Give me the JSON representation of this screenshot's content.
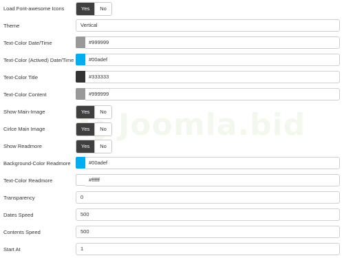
{
  "rows": {
    "load_icons": {
      "label": "Load Font-awesome Icons",
      "yes": "Yes",
      "no": "No",
      "selected": "Yes"
    },
    "theme": {
      "label": "Theme",
      "value": "Vertical"
    },
    "text_color_datetime": {
      "label": "Text-Color Date/Time",
      "value": "#999999",
      "color": "#999999"
    },
    "text_color_actived": {
      "label": "Text-Color (Actived) Date/Time",
      "value": "#00adef",
      "color": "#00adef"
    },
    "text_color_title": {
      "label": "Text-Color Title",
      "value": "#333333",
      "color": "#333333"
    },
    "text_color_content": {
      "label": "Text-Color Content",
      "value": "#999999",
      "color": "#999999"
    },
    "show_main_image": {
      "label": "Show Main-Image",
      "yes": "Yes",
      "no": "No",
      "selected": "Yes"
    },
    "circle_main_image": {
      "label": "Cirlce Main Image",
      "yes": "Yes",
      "no": "No",
      "selected": "Yes"
    },
    "show_readmore": {
      "label": "Show Readmore",
      "yes": "Yes",
      "no": "No",
      "selected": "Yes"
    },
    "bg_color_readmore": {
      "label": "Background-Color Readmore",
      "value": "#00adef",
      "color": "#00adef"
    },
    "text_color_readmore": {
      "label": "Text-Color Readmore",
      "value": "#ffffff",
      "color": "#ffffff"
    },
    "transparency": {
      "label": "Transparency",
      "value": "0"
    },
    "dates_speed": {
      "label": "Dates Speed",
      "value": "500"
    },
    "contents_speed": {
      "label": "Contents Speed",
      "value": "500"
    },
    "start_at": {
      "label": "Start At",
      "value": "1"
    }
  },
  "watermark": {
    "text": "Joomla.bid",
    "color": "#b9d7a3"
  }
}
